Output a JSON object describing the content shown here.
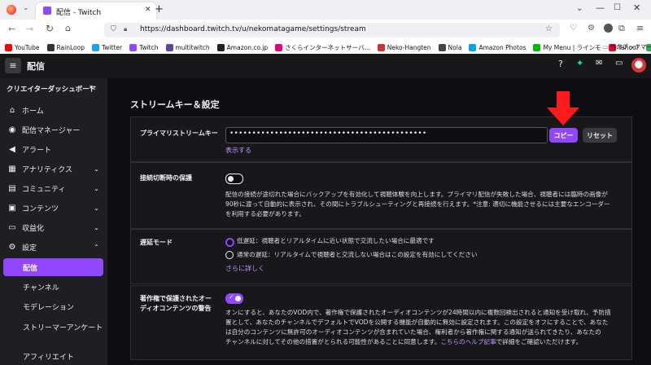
{
  "browser": {
    "tab_title": "配信 - Twitch",
    "new_tab": "+",
    "url": "https://dashboard.twitch.tv/u/nekomatagame/settings/stream",
    "bookmarks": [
      {
        "label": "YouTube",
        "color": "#ff0000"
      },
      {
        "label": "RainLoop",
        "color": "#333333"
      },
      {
        "label": "Twitter",
        "color": "#1da1f2"
      },
      {
        "label": "Twitch",
        "color": "#9147ff"
      },
      {
        "label": "multitwitch",
        "color": "#6441a5"
      },
      {
        "label": "Amazon.co.jp",
        "color": "#222222"
      },
      {
        "label": "さくらインターネットサーバ...",
        "color": "#e4007f"
      },
      {
        "label": "Neko-Hangten",
        "color": "#cc3333"
      },
      {
        "label": "Nola",
        "color": "#444444"
      },
      {
        "label": "Amazon Photos",
        "color": "#00a8e1"
      },
      {
        "label": "My Menu | ラインモ",
        "color": "#00b900"
      },
      {
        "label": "Yahoo!",
        "color": "#ff0033"
      },
      {
        "label": "マップ",
        "color": "#34a853"
      }
    ],
    "other_bookmarks": "他のブックマーク"
  },
  "twitch": {
    "page_title": "配信",
    "sidebar_title": "クリエイターダッシュボード",
    "sidebar_items": [
      {
        "label": "ホーム",
        "icon": "home-icon"
      },
      {
        "label": "配信マネージャー",
        "icon": "broadcast-icon"
      },
      {
        "label": "アラート",
        "icon": "megaphone-icon"
      },
      {
        "label": "アナリティクス",
        "icon": "chart-icon"
      },
      {
        "label": "コミュニティ",
        "icon": "community-icon"
      },
      {
        "label": "コンテンツ",
        "icon": "content-icon"
      },
      {
        "label": "収益化",
        "icon": "money-icon"
      },
      {
        "label": "設定",
        "icon": "gear-icon"
      }
    ],
    "sub_items": [
      "配信",
      "チャンネル",
      "モデレーション",
      "ストリーマーアンケート",
      "アフィリエイト"
    ]
  },
  "content": {
    "section_title": "ストリームキー＆設定",
    "stream_key": {
      "label": "プライマリストリームキー",
      "value": "••••••••••••••••••••••••••••••••••••••••••••",
      "copy": "コピー",
      "reset": "リセット",
      "show": "表示する"
    },
    "disconnect": {
      "label": "接続切断時の保護",
      "line1": "配信の接続が途切れた場合にバックアップを有効化して視聴体験を向上します。プライマリ配信が失敗した場合、視聴者には臨時の画像が",
      "line2": "90秒に渡って自動的に表示され、その間にトラブルシューティングと再接続を行えます。*注意: 適切に機能させるには主要なエンコーダー",
      "line3": "を利用する必要があります。"
    },
    "latency": {
      "label": "遅延モード",
      "option1": "低遅延：視聴者とリアルタイムに近い状態で交流したい場合に最適です",
      "option2": "通常の遅延：リアルタイムで視聴者と交流しない場合はこの設定を有効にしてください",
      "more": "さらに詳しく"
    },
    "copyright": {
      "label1": "著作権で保護されたオー",
      "label2": "ディオコンテンツの警告",
      "line1": "オンにすると、あなたのVOD内で、著作権で保護されたオーディオコンテンツが24時間以内に複数回検出されると通知を受け取れ、予防措",
      "line2": "置として、あなたのチャンネルでデフォルトでVODを公開する機能が自動的に無効に設定されます。この設定をオフにすることで、あなた",
      "line3": "は自分のコンテンツに無許可のオーディオコンテンツが含まれていた場合、権利者から著作権に関する通知が送られてきたり、あなたの",
      "line4": "チャンネルに対してその他の措置がとられる可能性があることに同意します。",
      "help": "こちらのヘルプ記事",
      "tail": "で詳細をご確認いただけます。"
    }
  },
  "colors": {
    "accent": "#9147ff",
    "arrow": "#ff1a1a"
  }
}
